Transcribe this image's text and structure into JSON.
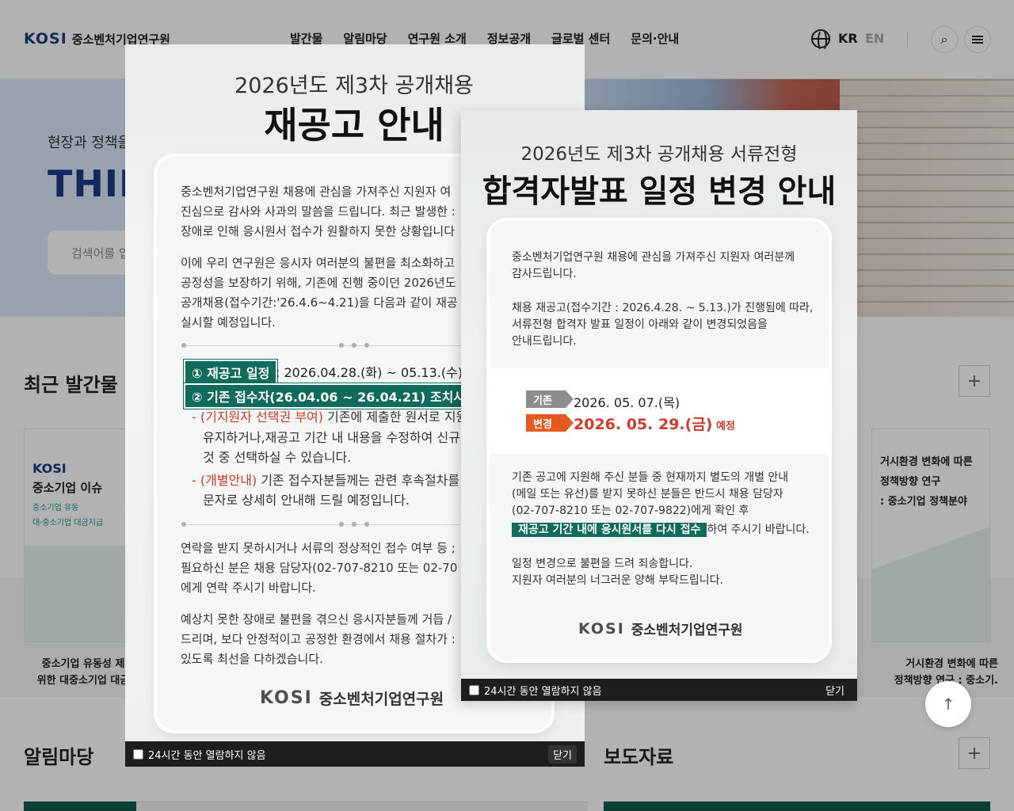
{
  "header": {
    "logo_mark": "KOSI",
    "logo_text": "중소벤처기업연구원",
    "nav": [
      "발간물",
      "알림마당",
      "연구원 소개",
      "정보공개",
      "글로벌 센터",
      "문의·안내"
    ],
    "lang_kr": "KR",
    "lang_en": "EN"
  },
  "hero": {
    "subtitle": "현장과 정책을",
    "title": "THINK",
    "search_placeholder": "검색어를 입"
  },
  "sections": {
    "recent_publications": "최근 발간물",
    "notices": "알림마당",
    "press": "보도자료",
    "plus": "+"
  },
  "publications": {
    "left_logo": "KOSI",
    "left_title": "중소기업 이슈",
    "left_sub1": "중소기업 유동",
    "left_sub2": "대·중소기업 대금지급",
    "left_caption_1": "중소기업 유동성 제",
    "left_caption_2": "위한 대중소기업 대금",
    "right_title_1": "거시환경 변화에 따른",
    "right_title_2": "정책방향 연구",
    "right_title_3": ": 중소기업 정책분야",
    "right_caption_1": "거시환경 변화에 따른",
    "right_caption_2": "정책방향 연구 : 중소기."
  },
  "popup1": {
    "pretitle": "2026년도 제3차 공개채용",
    "title": "재공고 안내",
    "p1": [
      "중소벤처기업연구원 채용에 관심을 가져주신 지원자 여",
      "진심으로 감사와 사과의 말씀을 드립니다. 최근 발생한 :",
      "장애로 인해 응시원서 접수가 원활하지 못한 상황입니다"
    ],
    "p2": [
      "이에 우리 연구원은 응시자 여러분의 불편을 최소화하고",
      "공정성을 보장하기 위해, 기존에 진행 중이던 2026년도",
      "공개채용(접수기간:'26.4.6~4.21)을 다음과 같이 재공",
      "실시할 예정입니다."
    ],
    "tag1": "① 재공고 일정",
    "tag1_value": ": 2026.04.28.(화) ~ 05.13.(수) 1(",
    "tag2": "② 기존 접수자(26.04.06 ~ 26.04.21) 조치사항",
    "b1_red": "- (기지원자 선택권 부여)",
    "b1_rest": " 기존에 제출한 원서로 지원",
    "b1_l2": "유지하거나,재공고 기간 내 내용을 수정하여 신규 저",
    "b1_l3": "것 중 선택하실 수 있습니다.",
    "b2_red": "- (개별안내)",
    "b2_rest": " 기존 접수자분들께는 관련 후속절차를 (",
    "b2_l2": "문자로 상세히 안내해 드릴 예정입니다.",
    "p3": [
      "연락을 받지 못하시거나 서류의 정상적인 접수 여부 등 ;",
      "필요하신 분은 채용 담당자(02-707-8210 또는 02-70",
      "에게 연락 주시기 바랍니다."
    ],
    "p4": [
      "예상치 못한 장애로 불편을 겪으신 응시자분들께 거듭 ∕",
      "드리며, 보다 안정적이고 공정한 환경에서 채용 절차가 :",
      "있도록 최선을 다하겠습니다."
    ],
    "logo_mark": "KOSI",
    "logo_text": "중소벤처기업연구원",
    "footer_check": "24시간 동안 열람하지 않음",
    "footer_close": "닫기"
  },
  "popup2": {
    "pretitle": "2026년도 제3차 공개채용 서류전형",
    "title": "합격자발표 일정 변경 안내",
    "p1": [
      "중소벤처기업연구원 채용에 관심을 가져주신 지원자 여러분께",
      "감사드립니다."
    ],
    "p2": [
      "채용 재공고(접수기간 : 2026.4.28. ~ 5.13.)가 진행됨에 따라,",
      "서류전형 합격자 발표 일정이 아래와 같이 변경되었음을",
      "안내드립니다."
    ],
    "badge_old": "기존",
    "date_old": "2026. 05. 07.(목)",
    "badge_new": "변경",
    "date_new": "2026. 05. 29.(금)",
    "date_new_suffix": " 예정",
    "p3": [
      "기존 공고에 지원해 주신 분들 중 현재까지 별도의 개별 안내",
      "(메일 또는 유선)를 받지 못하신 분들은 반드시 채용 담당자",
      "(02-707-8210 또는 02-707-9822)에게 확인 후"
    ],
    "p3_highlight": "재공고 기간 내에 응시원서를 다시 접수",
    "p3_tail": "하여 주시기 바랍니다.",
    "p4": [
      "일정 변경으로 불편을 드려 죄송합니다.",
      "지원자 여러분의 너그러운 양해 부탁드립니다."
    ],
    "logo_mark": "KOSI",
    "logo_text": "중소벤처기업연구원",
    "footer_check": "24시간 동안 열람하지 않음",
    "footer_close": "닫기"
  },
  "icons": {
    "search": "⌕",
    "scroll_top": "↑"
  },
  "colors": {
    "brand_green": "#0f6b5c",
    "brand_navy": "#1b3f7a",
    "alert_red": "#d23b2b",
    "badge_orange": "#e55a1f"
  }
}
